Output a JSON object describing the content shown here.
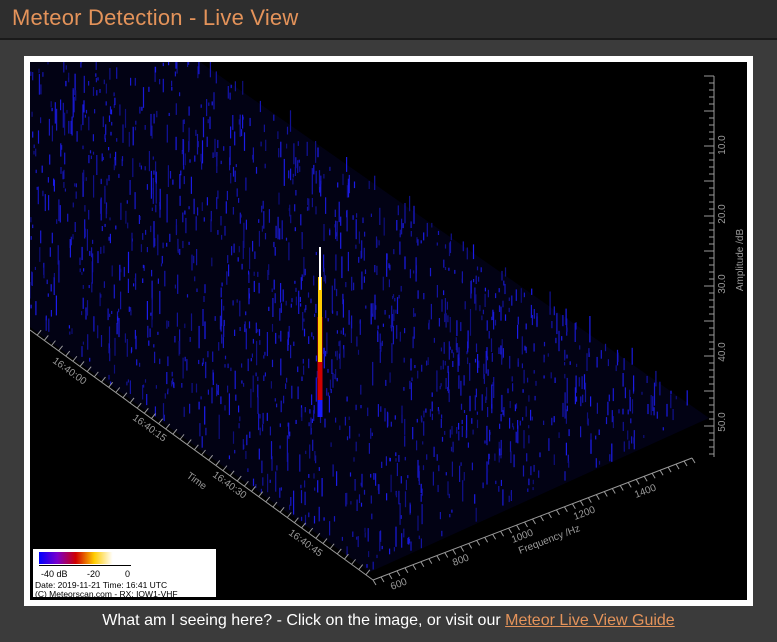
{
  "header": {
    "title": "Meteor Detection - Live View"
  },
  "spectrogram": {
    "amplitude_axis": {
      "label": "Amplitude /dB",
      "ticks": [
        "10.0",
        "20.0",
        "30.0",
        "40.0",
        "50.0"
      ]
    },
    "time_axis": {
      "label": "Time",
      "ticks": [
        "16:40:00",
        "16:40:15",
        "16:40:30",
        "16:40:45"
      ]
    },
    "frequency_axis": {
      "label": "Frequency /Hz",
      "ticks": [
        "600",
        "800",
        "1000",
        "1200",
        "1400"
      ]
    },
    "colors": {
      "background": "#000000",
      "noise": "#1a1acc",
      "meteor_low": "#cc0000",
      "meteor_mid": "#ffcc00",
      "meteor_peak": "#ffffff"
    }
  },
  "legend": {
    "scale_labels": [
      "-40 dB",
      "-20",
      "0"
    ],
    "date_line": "Date: 2019-11-21   Time: 16:41  UTC",
    "copyright_line": "(C) Meteorscan.com - RX: IOW1-VHF"
  },
  "footer": {
    "text": "What am I seeing here? - Click on the image, or visit our ",
    "link_label": "Meteor Live View Guide"
  }
}
